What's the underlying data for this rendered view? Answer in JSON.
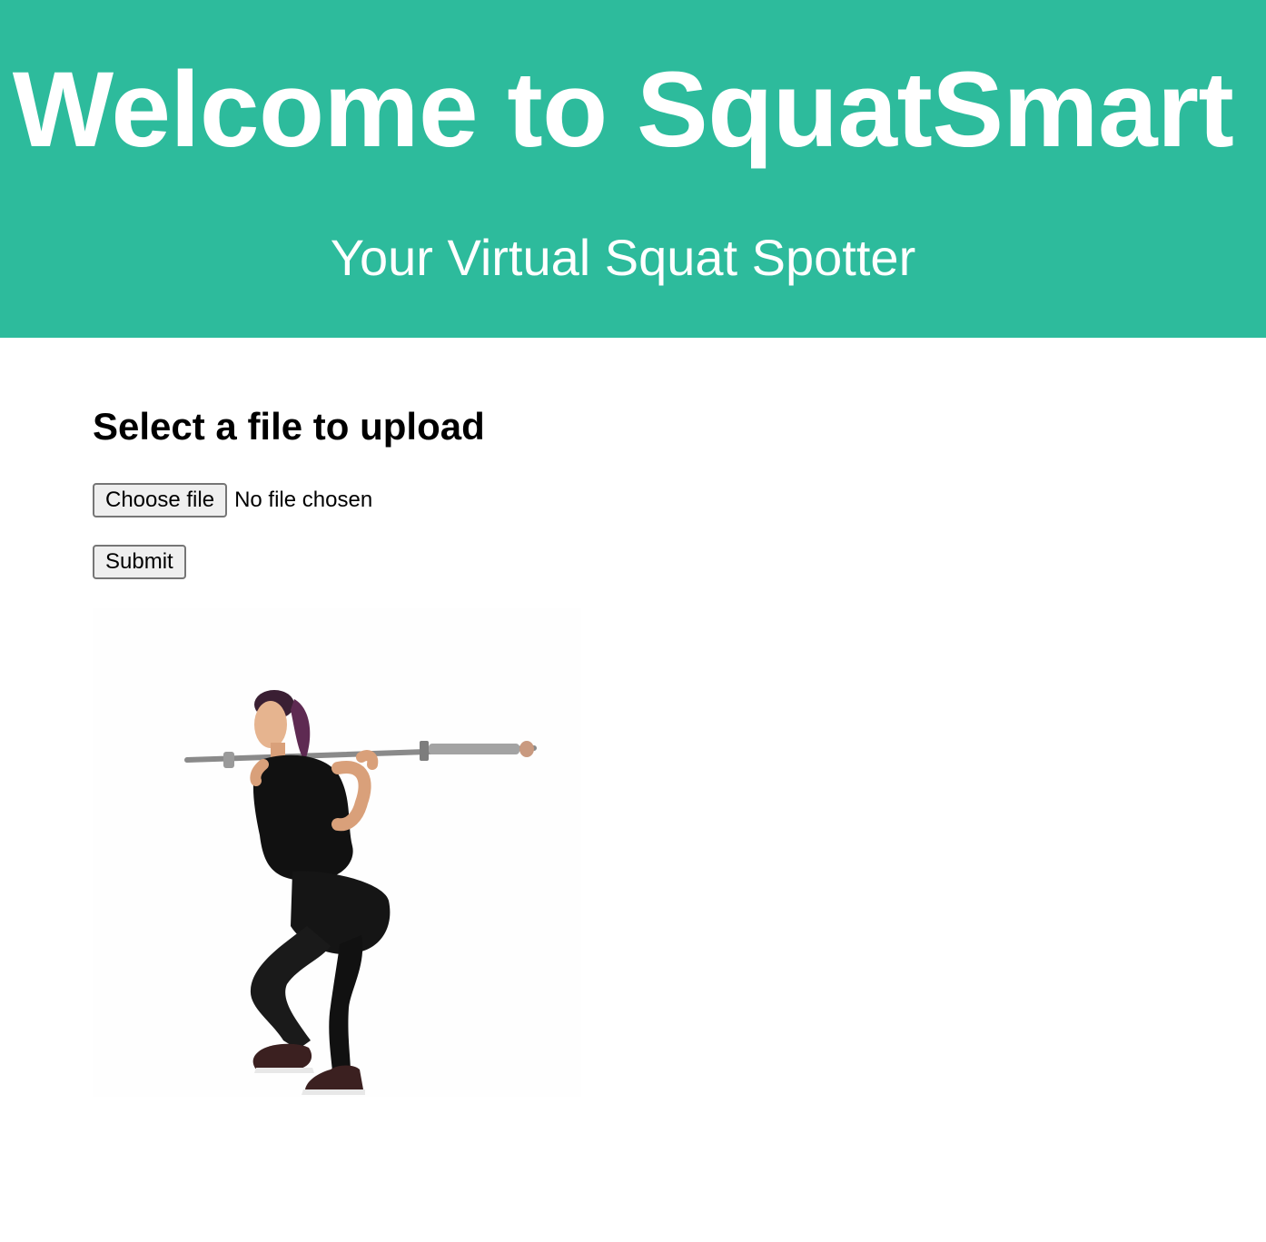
{
  "header": {
    "title": "Welcome to SquatSmart",
    "subtitle": "Your Virtual Squat Spotter",
    "background_color": "#2dbb9c"
  },
  "upload": {
    "heading": "Select a file to upload",
    "choose_button_label": "Choose file",
    "file_status": "No file chosen",
    "submit_label": "Submit"
  },
  "illustration": {
    "icon": "woman-barbell-squat-illustration"
  }
}
